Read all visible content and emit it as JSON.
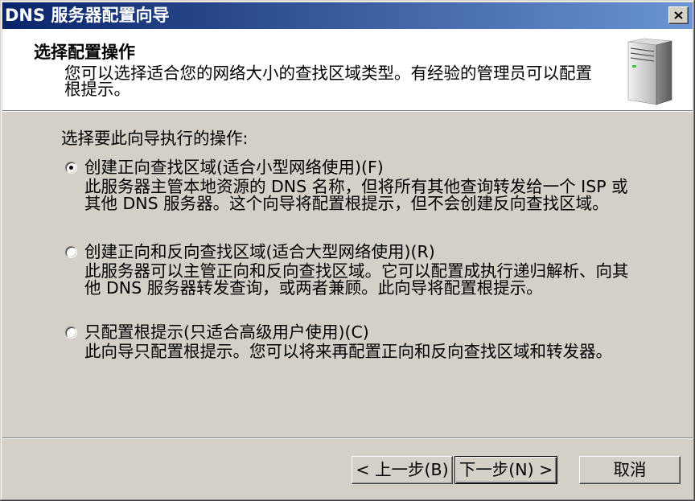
{
  "window": {
    "title": "DNS 服务器配置向导"
  },
  "header": {
    "title": "选择配置操作",
    "subtitle_lines": [
      "您可以选择适合您的网络大小的查找区域类型。有经验的管理员可以配置",
      "根提示。"
    ]
  },
  "body": {
    "prompt": "选择要此向导执行的操作:",
    "options": [
      {
        "label": "创建正向查找区域(适合小型网络使用)(F)",
        "description_lines": [
          "此服务器主管本地资源的 DNS 名称，但将所有其他查询转发给一个 ISP 或",
          "其他 DNS 服务器。这个向导将配置根提示，但不会创建反向查找区域。"
        ],
        "checked": true
      },
      {
        "label": "创建正向和反向查找区域(适合大型网络使用)(R)",
        "description_lines": [
          "此服务器可以主管正向和反向查找区域。它可以配置成执行递归解析、向其",
          "他 DNS 服务器转发查询，或两者兼顾。此向导将配置根提示。"
        ],
        "checked": false
      },
      {
        "label": "只配置根提示(只适合高级用户使用)(C)",
        "description_lines": [
          "此向导只配置根提示。您可以将来再配置正向和反向查找区域和转发器。"
        ],
        "checked": false
      }
    ]
  },
  "buttons": {
    "back": "< 上一步(B)",
    "next": "下一步(N) >",
    "cancel": "取消"
  },
  "icons": {
    "close": "close-icon",
    "header": "server-icon"
  },
  "colors": {
    "title_bar_start": "#0a246a",
    "title_bar_end": "#6b95d4",
    "title_text": "#ffffff",
    "dialog_face": "#d4d0c8",
    "header_background": "#ffffff"
  }
}
